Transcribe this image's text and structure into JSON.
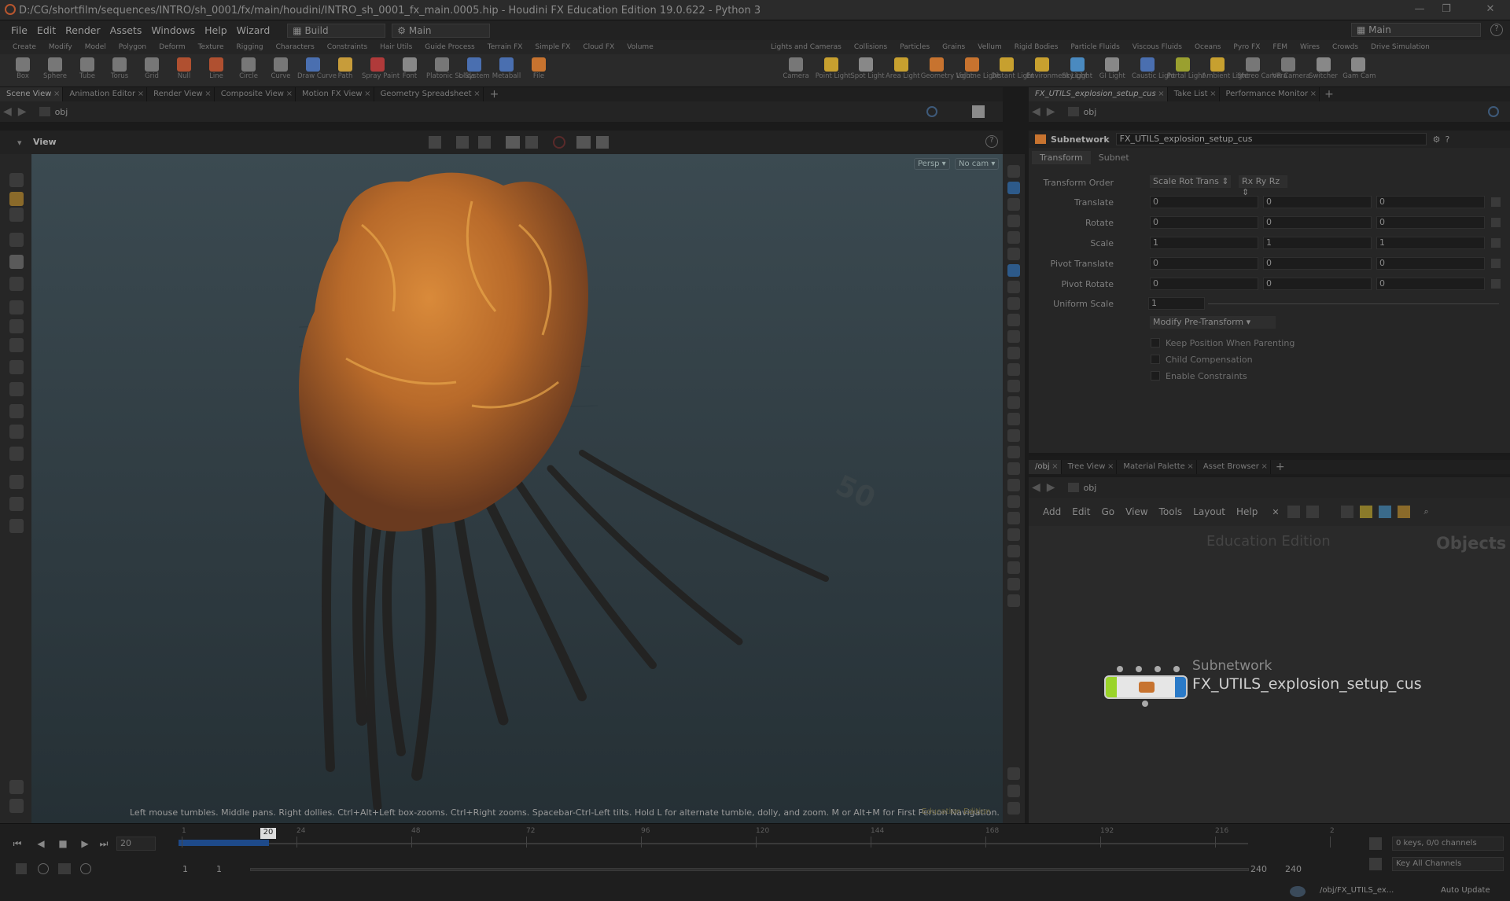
{
  "window": {
    "title": "D:/CG/shortfilm/sequences/INTRO/sh_0001/fx/main/houdini/INTRO_sh_0001_fx_main.0005.hip - Houdini FX Education Edition 19.0.622 - Python 3"
  },
  "menubar": {
    "items": [
      "File",
      "Edit",
      "Render",
      "Assets",
      "Windows",
      "Help",
      "Wizard"
    ],
    "desktop": "Build",
    "shelfset": "Main",
    "right_desktop": "Main"
  },
  "shelf_tabs_left": [
    "Create",
    "Modify",
    "Model",
    "Polygon",
    "Deform",
    "Texture",
    "Rigging",
    "Characters",
    "Constraints",
    "Hair Utils",
    "Guide Process",
    "Terrain FX",
    "Simple FX",
    "Cloud FX",
    "Volume"
  ],
  "shelf_tabs_right": [
    "Lights and Cameras",
    "Collisions",
    "Particles",
    "Grains",
    "Vellum",
    "Rigid Bodies",
    "Particle Fluids",
    "Viscous Fluids",
    "Oceans",
    "Pyro FX",
    "FEM",
    "Wires",
    "Crowds",
    "Drive Simulation"
  ],
  "tools_left": [
    {
      "label": "Box",
      "color": "#777"
    },
    {
      "label": "Sphere",
      "color": "#777"
    },
    {
      "label": "Tube",
      "color": "#777"
    },
    {
      "label": "Torus",
      "color": "#777"
    },
    {
      "label": "Grid",
      "color": "#777"
    },
    {
      "label": "Null",
      "color": "#b05030"
    },
    {
      "label": "Line",
      "color": "#b05030"
    },
    {
      "label": "Circle",
      "color": "#777"
    },
    {
      "label": "Curve",
      "color": "#777"
    },
    {
      "label": "Draw Curve",
      "color": "#4a6fb0"
    },
    {
      "label": "Path",
      "color": "#c79c3a"
    },
    {
      "label": "Spray Paint",
      "color": "#b03a3a"
    },
    {
      "label": "Font",
      "color": "#888"
    },
    {
      "label": "Platonic Solids",
      "color": "#777"
    },
    {
      "label": "L-System",
      "color": "#4a6fb0"
    },
    {
      "label": "Metaball",
      "color": "#4a6fb0"
    },
    {
      "label": "File",
      "color": "#c7732f"
    }
  ],
  "tools_right": [
    {
      "label": "Camera",
      "color": "#777"
    },
    {
      "label": "Point Light",
      "color": "#c7a02f"
    },
    {
      "label": "Spot Light",
      "color": "#888"
    },
    {
      "label": "Area Light",
      "color": "#c7a02f"
    },
    {
      "label": "Geometry Light",
      "color": "#c7732f"
    },
    {
      "label": "Volume Light",
      "color": "#c7732f"
    },
    {
      "label": "Distant Light",
      "color": "#c7a02f"
    },
    {
      "label": "Environment Light",
      "color": "#c7a02f"
    },
    {
      "label": "Sky Light",
      "color": "#4a8ac0"
    },
    {
      "label": "GI Light",
      "color": "#888"
    },
    {
      "label": "Caustic Light",
      "color": "#4a6fb0"
    },
    {
      "label": "Portal Light",
      "color": "#9aa02f"
    },
    {
      "label": "Ambient Light",
      "color": "#c7a02f"
    },
    {
      "label": "Stereo Camera",
      "color": "#777"
    },
    {
      "label": "VR Camera",
      "color": "#777"
    },
    {
      "label": "Switcher",
      "color": "#888"
    },
    {
      "label": "Gam Cam",
      "color": "#888"
    }
  ],
  "left_pane_tabs": [
    "Scene View",
    "Animation Editor",
    "Render View",
    "Composite View",
    "Motion FX View",
    "Geometry Spreadsheet"
  ],
  "right_top_tabs": [
    "FX_UTILS_explosion_setup_cus",
    "Take List",
    "Performance Monitor"
  ],
  "right_bottom_tabs": [
    "/obj",
    "Tree View",
    "Material Palette",
    "Asset Browser"
  ],
  "scene_path": "obj",
  "viewport": {
    "label": "View",
    "camera_view": "Persp",
    "camera": "No cam",
    "grid_number": "50",
    "hint": "Left mouse tumbles. Middle pans. Right dollies. Ctrl+Alt+Left box-zooms. Ctrl+Right zooms. Spacebar-Ctrl-Left tilts. Hold L for alternate tumble, dolly, and zoom.    M or Alt+M for First Person Navigation.",
    "edu_tag": "Education Edition"
  },
  "params": {
    "path": "obj",
    "node_type": "Subnetwork",
    "node_name": "FX_UTILS_explosion_setup_cus",
    "tabs": [
      "Transform",
      "Subnet"
    ],
    "transform_order_label": "Transform Order",
    "transform_order": "Scale Rot Trans",
    "rot_order": "Rx Ry Rz",
    "rows": [
      {
        "label": "Translate",
        "values": [
          "0",
          "0",
          "0"
        ]
      },
      {
        "label": "Rotate",
        "values": [
          "0",
          "0",
          "0"
        ]
      },
      {
        "label": "Scale",
        "values": [
          "1",
          "1",
          "1"
        ]
      },
      {
        "label": "Pivot Translate",
        "values": [
          "0",
          "0",
          "0"
        ]
      },
      {
        "label": "Pivot Rotate",
        "values": [
          "0",
          "0",
          "0"
        ]
      }
    ],
    "uniform_scale_label": "Uniform Scale",
    "uniform_scale": "1",
    "modify_button": "Modify Pre-Transform",
    "checkboxes": [
      "Keep Position When Parenting",
      "Child Compensation",
      "Enable Constraints"
    ]
  },
  "network": {
    "path": "obj",
    "menu": [
      "Add",
      "Edit",
      "Go",
      "View",
      "Tools",
      "Layout",
      "Help"
    ],
    "watermark": "Education Edition",
    "context": "Objects",
    "node_type": "Subnetwork",
    "node_name": "FX_UTILS_explosion_setup_cus"
  },
  "timeline": {
    "current_frame": "20",
    "frame_marker": "20",
    "ticks": [
      "1",
      "24",
      "48",
      "72",
      "96",
      "120",
      "144",
      "168",
      "192",
      "216",
      "2"
    ],
    "range_start": "1",
    "range_start2": "1",
    "range_end": "240",
    "range_end2": "240",
    "keys_info": "0 keys, 0/0 channels",
    "key_all": "Key All Channels",
    "status_path": "/obj/FX_UTILS_ex...",
    "auto_update": "Auto Update"
  }
}
